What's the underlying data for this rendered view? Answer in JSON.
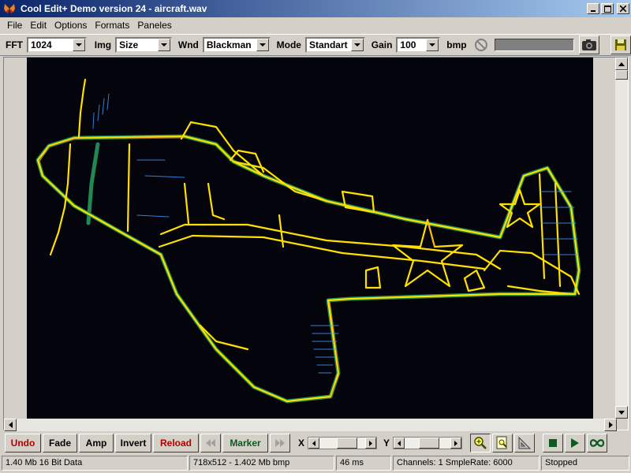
{
  "window": {
    "title": "Cool Edit+  Demo version 24 - aircraft.wav"
  },
  "menu": [
    "File",
    "Edit",
    "Options",
    "Formats",
    "Paneles"
  ],
  "toolbar": {
    "fft_label": "FFT",
    "fft_value": "1024",
    "img_label": "Img",
    "img_value": "Size",
    "wnd_label": "Wnd",
    "wnd_value": "Blackman",
    "mode_label": "Mode",
    "mode_value": "Standart",
    "gain_label": "Gain",
    "gain_value": "100",
    "bmp_label": "bmp"
  },
  "controls": {
    "undo": "Undo",
    "fade": "Fade",
    "amp": "Amp",
    "invert": "Invert",
    "reload": "Reload",
    "marker": "Marker",
    "x_label": "X",
    "y_label": "Y"
  },
  "status": {
    "data": "1.40 Mb 16 Bit Data",
    "bmp": "718x512 - 1.402 Mb bmp",
    "time": "46 ms",
    "channels": "Channels: 1  SmpleRate: 6000",
    "state": "Stopped"
  },
  "colors": {
    "accent_red": "#b00000",
    "accent_green": "#0b5a20",
    "canvas": "#04040c",
    "drawing": "#e8e000"
  },
  "icons": [
    "butterfly-icon",
    "no-symbol-icon",
    "camera-icon",
    "save-disk-icon",
    "rewind-icon",
    "fast-forward-icon",
    "zoom-in-icon",
    "zoom-fit-icon",
    "ruler-icon",
    "stop-icon",
    "play-icon",
    "loop-icon"
  ]
}
